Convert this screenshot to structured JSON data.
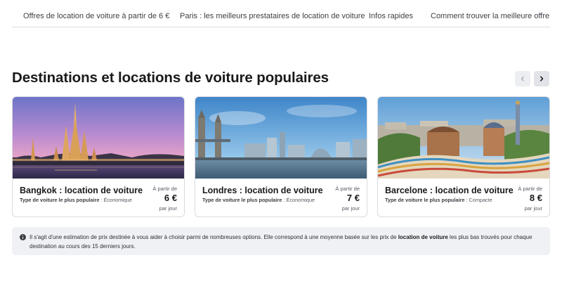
{
  "subnav": [
    {
      "label": "Offres de location de voiture à partir de 6 €"
    },
    {
      "label": "Paris : les meilleurs prestataires de location de voiture"
    },
    {
      "label": "Infos rapides"
    },
    {
      "label": "Comment trouver la meilleure offre"
    }
  ],
  "section": {
    "title": "Destinations et locations de voiture populaires"
  },
  "carousel": {
    "prev_icon": "chevron-left-icon",
    "next_icon": "chevron-right-icon"
  },
  "cards": [
    {
      "city": "Bangkok : location de voiture",
      "type_label": "Type de voiture le plus populaire",
      "type_value": "Économique",
      "from": "À partir de",
      "price": "6 €",
      "per": "par jour"
    },
    {
      "city": "Londres : location de voiture",
      "type_label": "Type de voiture le plus populaire",
      "type_value": "Économique",
      "from": "À partir de",
      "price": "7 €",
      "per": "par jour"
    },
    {
      "city": "Barcelone : location de voiture",
      "type_label": "Type de voiture le plus populaire",
      "type_value": "Compacte",
      "from": "À partir de",
      "price": "8 €",
      "per": "par jour"
    }
  ],
  "info": {
    "icon": "info-icon",
    "text_before": "Il s'agit d'une estimation de prix destinée à vous aider à choisir parmi de nombreuses options. Elle correspond à une moyenne basée sur les prix de ",
    "text_bold": "location de voiture",
    "text_after": " les plus bas trouvés pour chaque destination au cours des 15 derniers jours."
  }
}
